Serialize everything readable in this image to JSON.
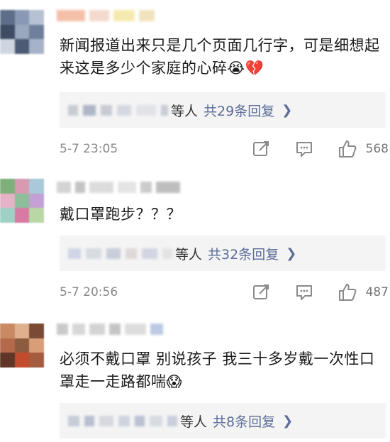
{
  "comments": [
    {
      "text": "新闻报道出来只是几个页面几行字，可是细想起来这是多少个家庭的心碎😭💔",
      "replies_suffix": "等人",
      "replies_label": "共29条回复",
      "timestamp": "5-7 23:05",
      "likes": "568",
      "avatar_colors": [
        "#5d6d8a",
        "#8a99b3",
        "#b7c1d4",
        "#3e4b63",
        "#9aa7bd",
        "#6f7f9b",
        "#cfd6e2",
        "#4c5a74",
        "#a6b2c7"
      ]
    },
    {
      "text": "戴口罩跑步？？？",
      "replies_suffix": "等人",
      "replies_label": "共32条回复",
      "timestamp": "5-7 20:56",
      "likes": "487",
      "avatar_colors": [
        "#7fb07a",
        "#d89ab0",
        "#a9c8d8",
        "#e6b3c6",
        "#8cbf9a",
        "#c3a0d6",
        "#9fd0c5",
        "#d77aa4",
        "#b9d7a4"
      ]
    },
    {
      "text": "必须不戴口罩 别说孩子 我三十多岁戴一次性口罩走一走路都喘😱",
      "replies_suffix": "等人",
      "replies_label": "共8条回复",
      "timestamp": "",
      "likes": "",
      "avatar_colors": [
        "#c98a63",
        "#e0b08e",
        "#7a4a34",
        "#b46a4a",
        "#8d5c3f",
        "#d99d78",
        "#5e3526",
        "#c44a2e",
        "#a45b3e"
      ]
    }
  ],
  "icons": {
    "share": "share-icon",
    "comment": "comment-icon",
    "like": "thumbs-up-icon",
    "chevron": "chevron-right-icon"
  },
  "colors": {
    "link": "#5b6d98",
    "meta": "#8a8a8a",
    "reply_bg": "#f4f4f4"
  }
}
